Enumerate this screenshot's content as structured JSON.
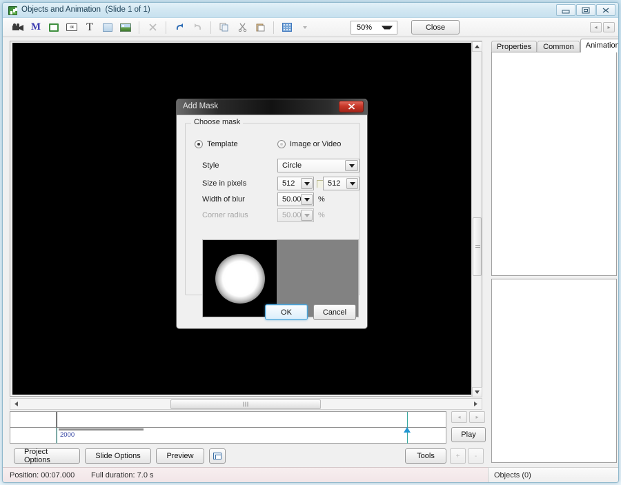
{
  "window": {
    "title": "Objects and Animation",
    "subtitle": "(Slide 1 of 1)",
    "icon": "app-icon",
    "controls": {
      "minimize": "minimize-icon",
      "maximize": "restore-icon",
      "close": "close-icon"
    }
  },
  "toolbar": {
    "items": [
      {
        "name": "video-tool",
        "glyph": "video-camera-icon"
      },
      {
        "name": "mask-tool",
        "glyph": "M"
      },
      {
        "name": "frame-tool",
        "glyph": "frame-icon"
      },
      {
        "name": "button-tool",
        "glyph": "ok"
      },
      {
        "name": "text-tool",
        "glyph": "T"
      },
      {
        "name": "rectangle-tool",
        "glyph": "rectangle-icon"
      },
      {
        "name": "image-tool",
        "glyph": "image-icon"
      }
    ],
    "delete_label": "delete-icon",
    "undo_label": "undo-icon",
    "redo_label": "redo-icon",
    "copy_label": "copy-icon",
    "cut_label": "cut-icon",
    "paste_label": "paste-icon",
    "grid_label": "grid-icon",
    "zoom_value": "50%",
    "close_label": "Close"
  },
  "right_panel": {
    "tabs": [
      {
        "label": "Properties",
        "active": false
      },
      {
        "label": "Common",
        "active": false
      },
      {
        "label": "Animation",
        "active": true
      }
    ],
    "nav_prev": "◂",
    "nav_next": "▸"
  },
  "timeline": {
    "time_label": "2000",
    "nav_prev": "◂",
    "nav_next": "▸",
    "play_label": "Play",
    "play_accel": "P"
  },
  "bottom_buttons": {
    "project_options": "Project Options",
    "slide_options": "Slide Options",
    "preview": "Preview",
    "layers_icon": "layers-icon",
    "tools": "Tools",
    "plus": "+",
    "minus": "-"
  },
  "statusbar": {
    "position": "Position:  00:07.000",
    "duration": "Full duration:  7.0 s",
    "objects": "Objects (0)"
  },
  "dialog": {
    "title": "Add Mask",
    "close_glyph": "✕",
    "group_legend": "Choose mask",
    "radio_template": "Template",
    "radio_image_or_video": "Image or Video",
    "template_selected": true,
    "label_style": "Style",
    "style_value": "Circle",
    "label_size": "Size in pixels",
    "size_width": "512",
    "size_height": "512",
    "label_blur": "Width of blur",
    "blur_value": "50.00",
    "blur_unit": "%",
    "label_corner_radius": "Corner radius",
    "corner_radius_value": "50.00",
    "corner_radius_unit": "%",
    "corner_radius_disabled": true,
    "preview_name": "mask-preview",
    "ok_label": "OK",
    "cancel_label": "Cancel"
  },
  "colors": {
    "accent": "#2196d3",
    "dialog_close_red": "#c8382a",
    "playhead_green": "#3ba9a0",
    "timeline_time_text": "#2e3fa0"
  }
}
